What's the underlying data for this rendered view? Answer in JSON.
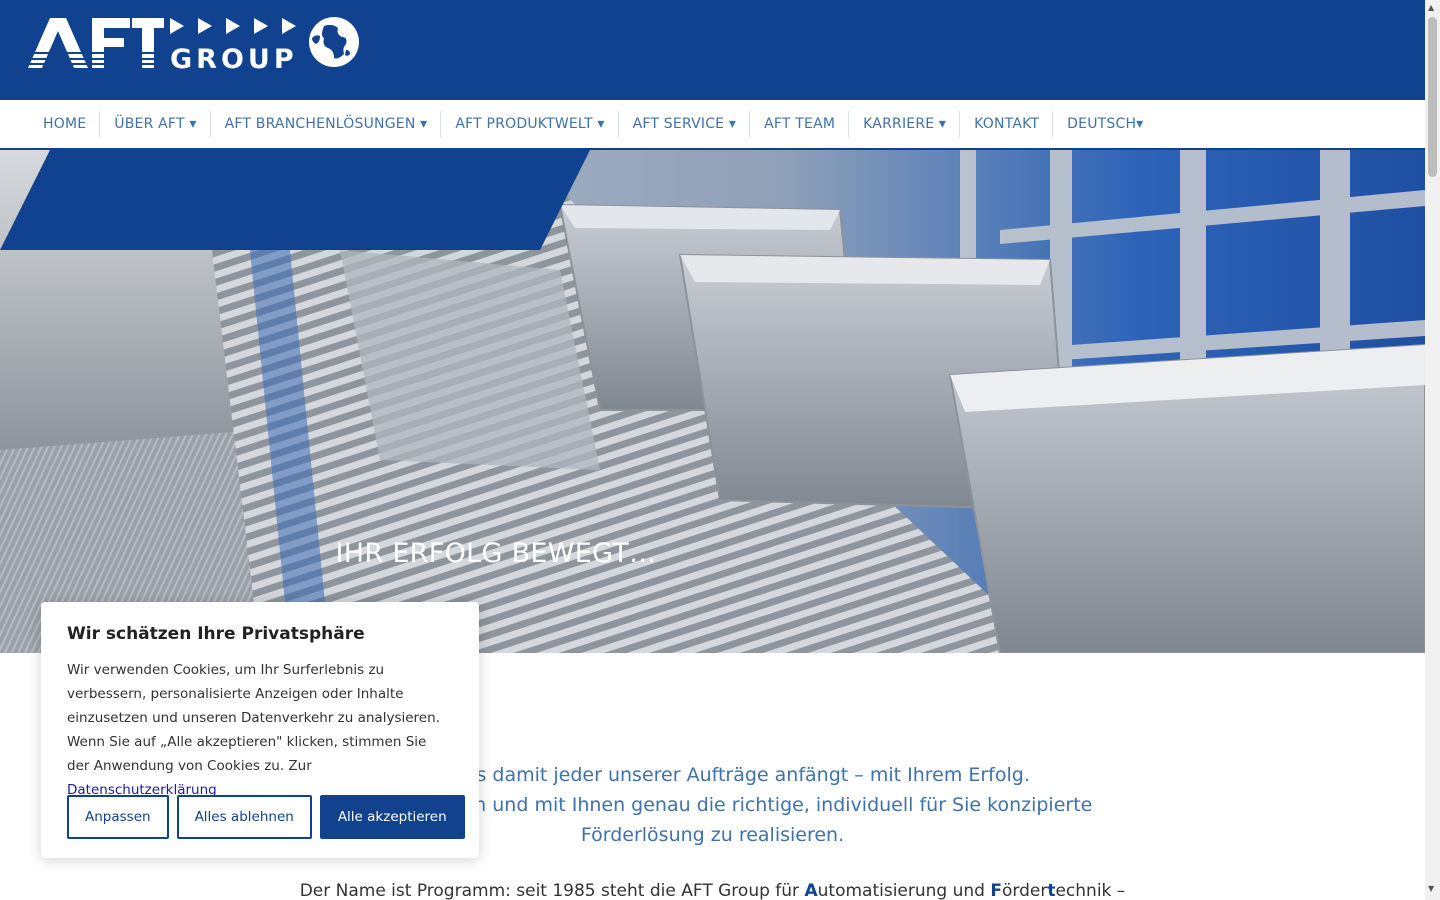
{
  "brand": {
    "logo_letters": "AFT",
    "logo_group": "GROUP"
  },
  "nav": {
    "items": [
      {
        "label": "HOME",
        "name": "nav-item-home"
      },
      {
        "label": "ÜBER AFT ▾",
        "name": "nav-item-ueber-aft"
      },
      {
        "label": "AFT BRANCHENLÖSUNGEN ▾",
        "name": "nav-item-branchenloesungen"
      },
      {
        "label": "AFT PRODUKTWELT ▾",
        "name": "nav-item-produktwelt"
      },
      {
        "label": "AFT SERVICE ▾",
        "name": "nav-item-service"
      },
      {
        "label": "AFT TEAM",
        "name": "nav-item-team"
      },
      {
        "label": "KARRIERE ▾",
        "name": "nav-item-karriere"
      },
      {
        "label": "KONTAKT",
        "name": "nav-item-kontakt"
      },
      {
        "label": "DEUTSCH▾",
        "name": "nav-item-language"
      }
    ]
  },
  "hero": {
    "title": "IHR ERFOLG BEWEGT…"
  },
  "intro": {
    "line1": "hön, dass damit jeder unserer Aufträge anfängt – mit Ihrem Erfolg.",
    "line2": "folg aufzubauen und mit Ihnen genau die richtige, individuell für Sie konzipierte",
    "line3": "Förderlösung zu realisieren."
  },
  "body": {
    "prefix": "Der Name ist Programm: seit 1985 steht die AFT Group für ",
    "a": "A",
    "a_rest": "utomatisierung und ",
    "f": "F",
    "f_rest": "örder",
    "t": "t",
    "t_rest": "echnik –"
  },
  "cookie": {
    "title": "Wir schätzen Ihre Privatsphäre",
    "text": "Wir verwenden Cookies, um Ihr Surferlebnis zu verbessern, personalisierte Anzeigen oder Inhalte einzusetzen und unseren Datenverkehr zu analysieren. Wenn Sie auf „Alle akzeptieren\" klicken, stimmen Sie der Anwendung von Cookies zu. Zur ",
    "link": "Datenschutzerklärung",
    "btn_customize": "Anpassen",
    "btn_reject": "Alles ablehnen",
    "btn_accept": "Alle akzeptieren"
  },
  "colors": {
    "brand_blue": "#11428f",
    "nav_text": "#3f72ad",
    "link": "#1a1aa8"
  }
}
